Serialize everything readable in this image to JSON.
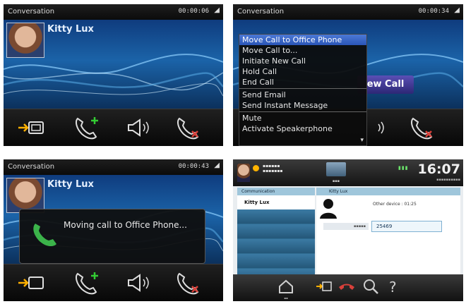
{
  "panel1": {
    "status_title": "Conversation",
    "status_time": "00:00:06",
    "contact_name": "Kitty Lux"
  },
  "panel2": {
    "status_title": "Conversation",
    "status_time": "00:00:34",
    "menu_items": [
      "Move Call to Office Phone",
      "Move Call to...",
      "Initiate New Call",
      "Hold Call",
      "End Call",
      "Send Email",
      "Send Instant Message",
      "Mute",
      "Activate Speakerphone"
    ],
    "selected_index": 0,
    "behind_button": "ew Call"
  },
  "panel3": {
    "status_title": "Conversation",
    "status_time": "00:00:43",
    "contact_name": "Kitty Lux",
    "dialog_message": "Moving call to Office Phone..."
  },
  "panel4": {
    "clock": "16:07",
    "communication_header": "Communication",
    "contact_header": "Kitty Lux",
    "active_contact": "Kitty Lux",
    "other_device": "Other device : 01:25",
    "field_value": "25469"
  },
  "colors": {
    "menu_selected": "#3a66c8",
    "call_button": "#3f3a9a",
    "hangup_icon": "#d9403a",
    "add_call_icon": "#33cc33",
    "dialog_phone": "#3bb34a"
  }
}
